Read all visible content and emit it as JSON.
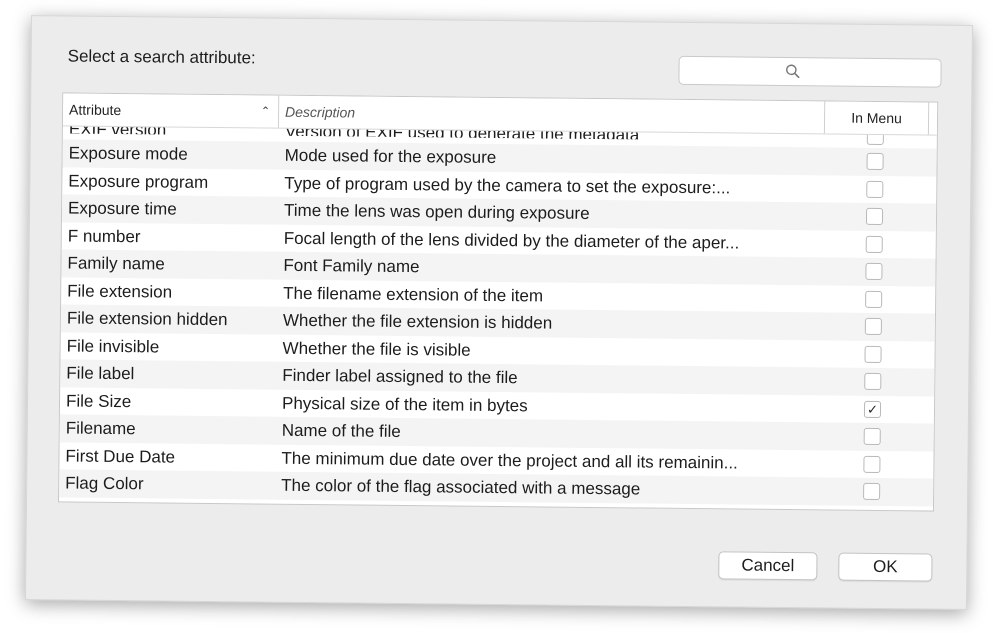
{
  "dialog": {
    "prompt": "Select a search attribute:",
    "search": {
      "placeholder": "",
      "value": ""
    },
    "columns": {
      "attribute": "Attribute",
      "description": "Description",
      "in_menu": "In Menu",
      "sort": "ascending"
    },
    "rows": [
      {
        "attribute": "EXIF version",
        "description": "Version of EXIF used to generate the metadata",
        "in_menu": false
      },
      {
        "attribute": "Exposure mode",
        "description": "Mode used for the exposure",
        "in_menu": false
      },
      {
        "attribute": "Exposure program",
        "description": "Type of program used by the camera to set the exposure:...",
        "in_menu": false
      },
      {
        "attribute": "Exposure time",
        "description": "Time the lens was open during exposure",
        "in_menu": false
      },
      {
        "attribute": "F number",
        "description": "Focal length of the lens divided by the diameter of the aper...",
        "in_menu": false
      },
      {
        "attribute": "Family name",
        "description": "Font Family name",
        "in_menu": false
      },
      {
        "attribute": "File extension",
        "description": "The filename extension of the item",
        "in_menu": false
      },
      {
        "attribute": "File extension hidden",
        "description": "Whether the file extension is hidden",
        "in_menu": false
      },
      {
        "attribute": "File invisible",
        "description": "Whether the file is visible",
        "in_menu": false
      },
      {
        "attribute": "File label",
        "description": "Finder label assigned to the file",
        "in_menu": false
      },
      {
        "attribute": "File Size",
        "description": "Physical size of the item in bytes",
        "in_menu": true
      },
      {
        "attribute": "Filename",
        "description": "Name of the file",
        "in_menu": false
      },
      {
        "attribute": "First Due Date",
        "description": "The minimum due date over the project and all its remainin...",
        "in_menu": false
      },
      {
        "attribute": "Flag Color",
        "description": "The color of the flag associated with a message",
        "in_menu": false
      }
    ],
    "buttons": {
      "cancel": "Cancel",
      "ok": "OK"
    },
    "icons": {
      "search": "magnifying-glass",
      "sort": "chevron-up",
      "check": "checkmark"
    }
  }
}
